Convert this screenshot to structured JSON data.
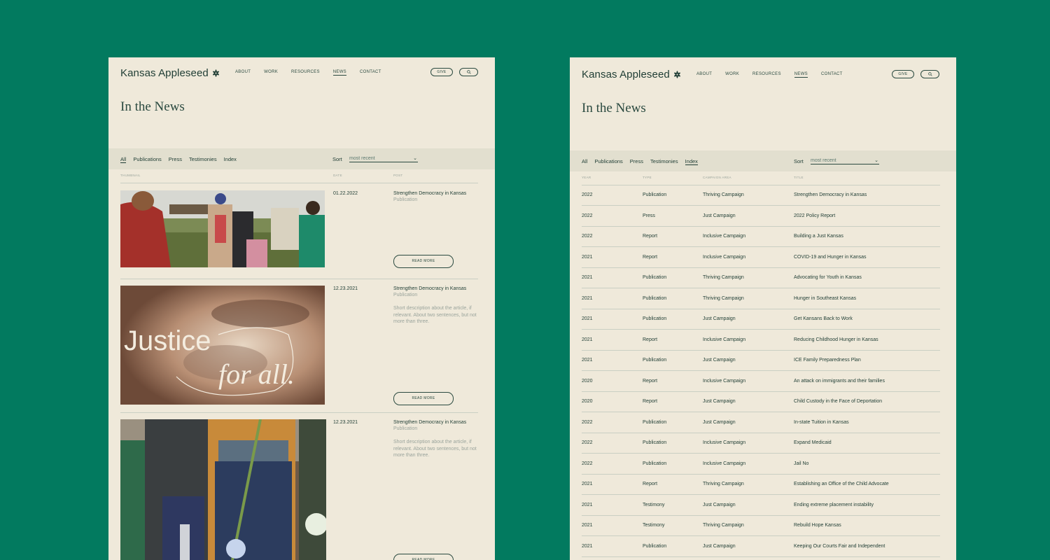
{
  "brand": "Kansas Appleseed",
  "nav": [
    "ABOUT",
    "WORK",
    "RESOURCES",
    "NEWS",
    "CONTACT"
  ],
  "nav_active": "NEWS",
  "give_label": "GIVE",
  "page_title": "In the News",
  "filters": [
    "All",
    "Publications",
    "Press",
    "Testimonies",
    "Index"
  ],
  "sort_label": "Sort",
  "sort_value": "most recent",
  "left": {
    "columns": [
      "THUMBNAIL",
      "DATE",
      "POST"
    ],
    "posts": [
      {
        "date": "01.22.2022",
        "title": "Strengthen Democracy in Kansas",
        "type": "Publication",
        "description": "",
        "button": "READ MORE"
      },
      {
        "date": "12.23.2021",
        "title": "Strengthen Democracy in Kansas",
        "type": "Publication",
        "description": "Short description about the article, if relevant. About two sentences, but not more than three.",
        "button": "READ MORE",
        "image_text": [
          "Justice",
          "for all."
        ]
      },
      {
        "date": "12.23.2021",
        "title": "Strengthen Democracy in Kansas",
        "type": "Publication",
        "description": "Short description about the article, if relevant. About two sentences, but not more than three.",
        "button": "READ MORE"
      }
    ]
  },
  "right": {
    "columns": [
      "YEAR",
      "TYPE",
      "CAMPAIGN AREA",
      "TITLE"
    ],
    "rows": [
      [
        "2022",
        "Publication",
        "Thriving Campaign",
        "Strengthen Democracy in Kansas"
      ],
      [
        "2022",
        "Press",
        "Just Campaign",
        "2022 Policy Report"
      ],
      [
        "2022",
        "Report",
        "Inclusive Campaign",
        "Building a Just Kansas"
      ],
      [
        "2021",
        "Report",
        "Inclusive Campaign",
        "COVID-19 and Hunger in Kansas"
      ],
      [
        "2021",
        "Publication",
        "Thriving Campaign",
        "Advocating for Youth in Kansas"
      ],
      [
        "2021",
        "Publication",
        "Thriving Campaign",
        "Hunger in Southeast Kansas"
      ],
      [
        "2021",
        "Publication",
        "Just Campaign",
        "Get Kansans Back to Work"
      ],
      [
        "2021",
        "Report",
        "Inclusive Campaign",
        "Reducing Childhood Hunger in Kansas"
      ],
      [
        "2021",
        "Publication",
        "Just Campaign",
        "ICE Family Preparedness Plan"
      ],
      [
        "2020",
        "Report",
        "Inclusive Campaign",
        "An attack on immigrants and their families"
      ],
      [
        "2020",
        "Report",
        "Just Campaign",
        "Child Custody in the Face of Deportation"
      ],
      [
        "2022",
        "Publication",
        "Just Campaign",
        "In-state Tuition in Kansas"
      ],
      [
        "2022",
        "Publication",
        "Inclusive Campaign",
        "Expand Medicaid"
      ],
      [
        "2022",
        "Publication",
        "Inclusive Campaign",
        "Jail No"
      ],
      [
        "2021",
        "Report",
        "Thriving Campaign",
        "Establishing an Office of the Child Advocate"
      ],
      [
        "2021",
        "Testimony",
        "Just Campaign",
        "Ending extreme placement instability"
      ],
      [
        "2021",
        "Testimony",
        "Thriving Campaign",
        "Rebuild Hope Kansas"
      ],
      [
        "2021",
        "Publication",
        "Just Campaign",
        "Keeping Our Courts Fair and Independent"
      ]
    ]
  },
  "colors": {
    "background": "#027a5f",
    "panel": "#efe9da",
    "text": "#1f3d34",
    "muted": "#9aa49c"
  },
  "icons": [
    "appleseed-logo-icon",
    "search-icon",
    "chevron-down-icon"
  ]
}
